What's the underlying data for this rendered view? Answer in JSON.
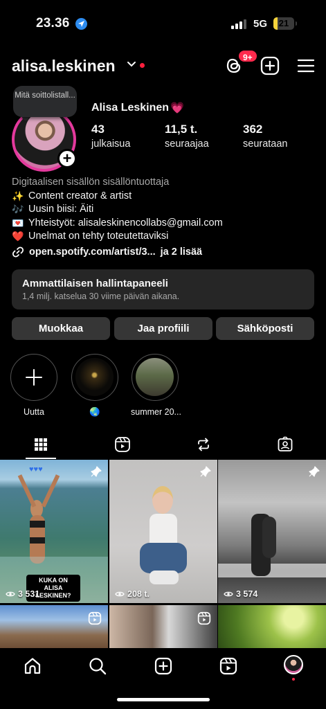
{
  "status_bar": {
    "time": "23.36",
    "network": "5G",
    "battery": "21",
    "battery_level": 0.21
  },
  "header": {
    "username": "alisa.leskinen",
    "notification_badge": "9+"
  },
  "profile": {
    "note": "Mitä soittolistall...",
    "full_name": "Alisa Leskinen",
    "name_emoji": "💗",
    "stats": [
      {
        "value": "43",
        "label": "julkaisua"
      },
      {
        "value": "11,5 t.",
        "label": "seuraajaa"
      },
      {
        "value": "362",
        "label": "seurataan"
      }
    ],
    "category": "Digitaalisen sisällön sisällöntuottaja",
    "bio_lines": [
      {
        "emoji": "✨",
        "text": "Content creator & artist"
      },
      {
        "emoji": "🎶",
        "text": "Uusin biisi: Äiti"
      },
      {
        "emoji": "💌",
        "text": "Yhteistyöt: alisaleskinencollabs@gmail.com"
      },
      {
        "emoji": "❤️",
        "text": "Unelmat on tehty toteutettaviksi"
      }
    ],
    "link": "open.spotify.com/artist/3...",
    "link_more": "ja 2 lisää"
  },
  "dashboard": {
    "title": "Ammattilaisen hallintapaneeli",
    "subtitle": "1,4 milj. katselua 30 viime päivän aikana."
  },
  "buttons": {
    "edit": "Muokkaa",
    "share": "Jaa profiili",
    "email": "Sähköposti"
  },
  "highlights": [
    {
      "label": "Uutta"
    },
    {
      "label": "🌏"
    },
    {
      "label": "summer 20..."
    }
  ],
  "tabs": [
    "posts-grid",
    "reels",
    "reposts",
    "tagged"
  ],
  "posts": [
    {
      "views": "3 531",
      "pinned": true,
      "caption": "KUKA ON ALISA LESKINEN?"
    },
    {
      "views": "208 t.",
      "pinned": true
    },
    {
      "views": "3 574",
      "pinned": true
    },
    {
      "reel": true
    },
    {
      "reel": true
    },
    {
      "reel": false
    }
  ],
  "colors": {
    "accent_red": "#ff2a4d",
    "ring_pink": "#e4399d",
    "button_bg": "#363636",
    "card_bg": "#262626"
  }
}
